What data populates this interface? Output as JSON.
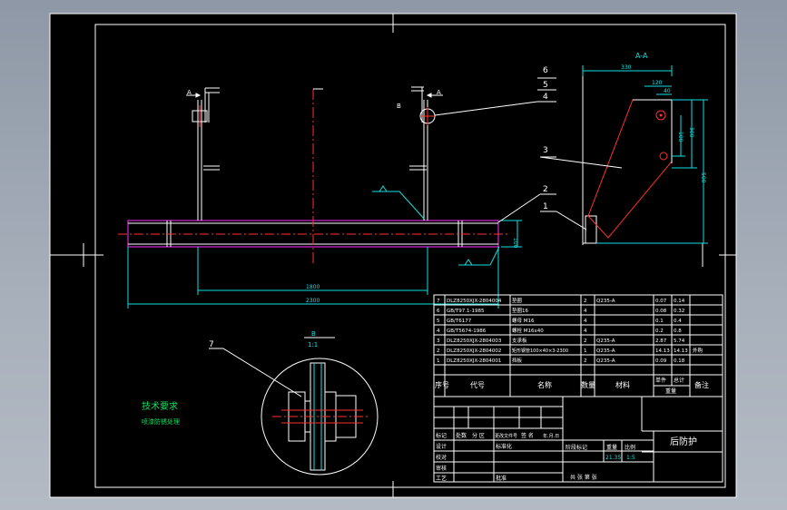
{
  "drawing": {
    "title": "后防护",
    "section_label": "A-A",
    "detail_label": "B",
    "detail_scale": "1:1",
    "notes_title": "技术要求",
    "notes_body": "喷漆防锈处理",
    "part_callouts": [
      "1",
      "2",
      "3",
      "4",
      "5",
      "6",
      "7"
    ],
    "dimensions": {
      "total_length": "2300",
      "inner_length": "1800",
      "beam_height": "100",
      "side_width": "330",
      "hole_offset_x": "120",
      "hole_dia": "40",
      "hole_offset_y": "100",
      "side_height_upper": "300",
      "side_height_total": "500"
    },
    "view_letters": [
      "A",
      "A",
      "B",
      "B"
    ]
  },
  "bom": {
    "header": {
      "seq": "序号",
      "code": "代号",
      "name": "名称",
      "qty": "数量",
      "material": "材料",
      "unit_weight": "单件",
      "total_weight": "总计",
      "weight": "重量",
      "remark": "备注"
    },
    "rows": [
      {
        "seq": "7",
        "code": "DLZ8250XJX-2804004",
        "name": "垫圈",
        "qty": "2",
        "material": "Q235-A",
        "unit": "0.07",
        "total": "0.14",
        "remark": ""
      },
      {
        "seq": "6",
        "code": "GB/T97.1-1985",
        "name": "垫圈16",
        "qty": "4",
        "material": "",
        "unit": "0.08",
        "total": "0.32",
        "remark": ""
      },
      {
        "seq": "5",
        "code": "GB/T6177",
        "name": "螺母 M16",
        "qty": "4",
        "material": "",
        "unit": "0.1",
        "total": "0.4",
        "remark": ""
      },
      {
        "seq": "4",
        "code": "GB/T5674-1986",
        "name": "螺栓 M16x40",
        "qty": "4",
        "material": "",
        "unit": "0.2",
        "total": "0.8",
        "remark": ""
      },
      {
        "seq": "3",
        "code": "DLZ8250XJX-2804003",
        "name": "支承板",
        "qty": "2",
        "material": "Q235-A",
        "unit": "2.87",
        "total": "5.74",
        "remark": ""
      },
      {
        "seq": "2",
        "code": "DLZ8250XJX-2804002",
        "name": "矩形钢管100×40×3-2300",
        "qty": "1",
        "material": "Q235-A",
        "unit": "14.13",
        "total": "14.13",
        "remark": "外购"
      },
      {
        "seq": "1",
        "code": "DLZ8250XJX-2804001",
        "name": "挡板",
        "qty": "2",
        "material": "Q235-A",
        "unit": "0.09",
        "total": "0.18",
        "remark": ""
      }
    ]
  },
  "title_block": {
    "marks_row": [
      "标记",
      "处数",
      "分 区",
      "更改文件号",
      "签 名",
      "年.月.日"
    ],
    "design": "设计",
    "standard": "标准化",
    "check": "校对",
    "review": "审核",
    "process": "工艺",
    "approve": "批准",
    "stage": "阶段标记",
    "weight_label": "重量",
    "scale_label": "比例",
    "weight_value": "21.35",
    "scale_value": "1:5",
    "sheets": "共 张 第 张"
  }
}
